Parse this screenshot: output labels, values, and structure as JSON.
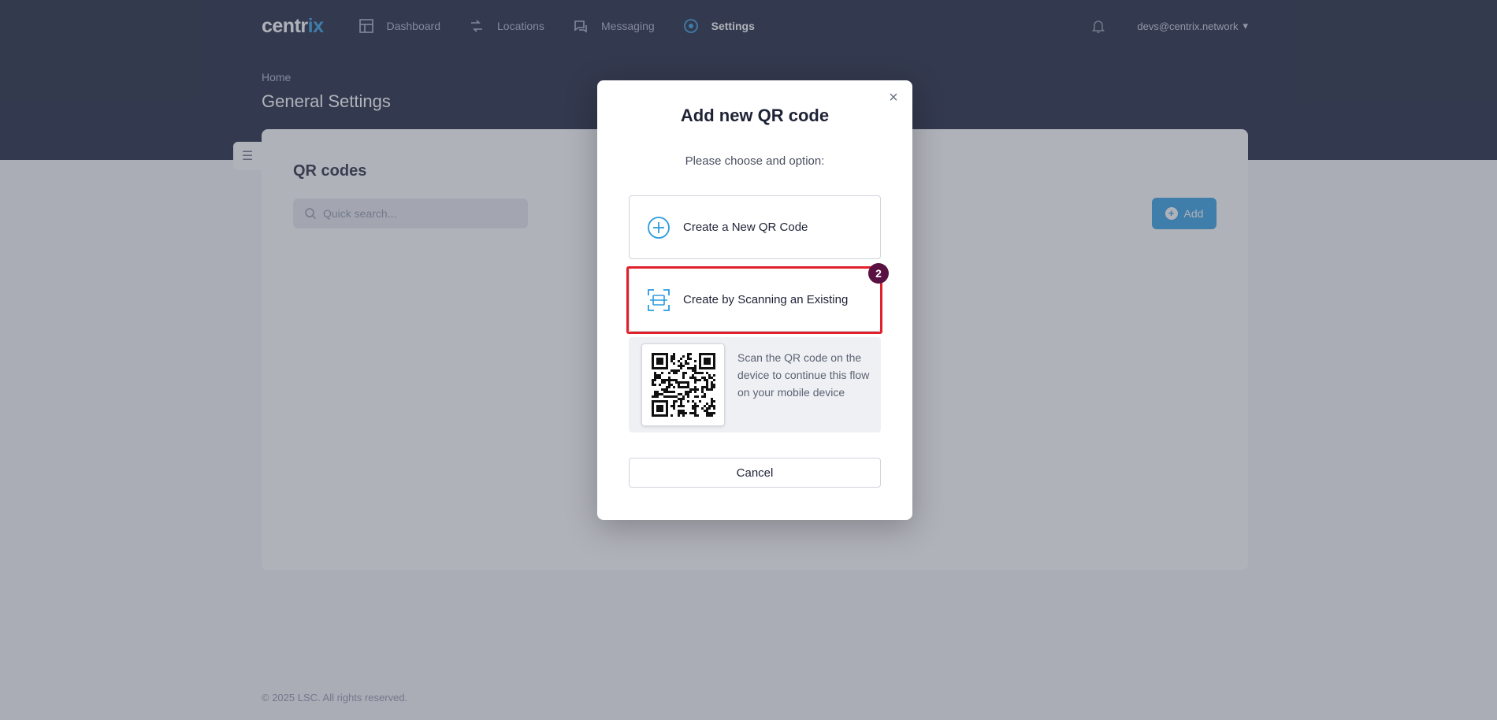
{
  "app": {
    "logo_main": "centr",
    "logo_accent": "ix",
    "nav": [
      {
        "label": "Dashboard",
        "icon": "dashboard-icon"
      },
      {
        "label": "Locations",
        "icon": "locations-icon"
      },
      {
        "label": "Messaging",
        "icon": "messaging-icon"
      },
      {
        "label": "Settings",
        "icon": "settings-icon",
        "active": true
      }
    ],
    "user_email": "devs@centrix.network",
    "breadcrumb": "Home",
    "page_title": "General Settings",
    "footer": "© 2025 LSC. All rights reserved."
  },
  "card": {
    "title": "QR codes",
    "search_placeholder": "Quick search...",
    "add_label": "Add"
  },
  "modal": {
    "title": "Add new QR code",
    "subtitle": "Please choose and option:",
    "option_new_label": "Create a New QR Code",
    "option_scan_label": "Create by Scanning an Existing",
    "qr_help_text": "Scan the QR code on the device to continue this flow on your mobile device",
    "cancel_label": "Cancel",
    "step_badge": "2"
  },
  "colors": {
    "nav_bg": "#141b34",
    "accent": "#2b9be0",
    "highlight": "#e0212b",
    "badge": "#5a1040"
  }
}
